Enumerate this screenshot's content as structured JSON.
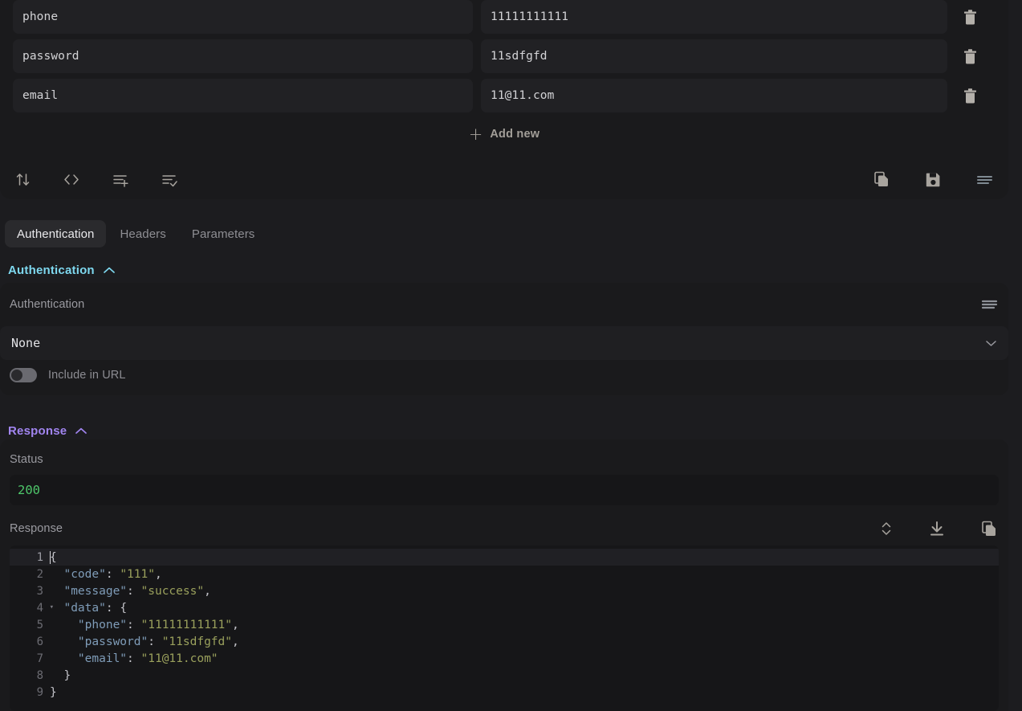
{
  "body_editor": {
    "rows": [
      {
        "key": "phone",
        "value": "11111111111",
        "delete_icon": "trash-icon"
      },
      {
        "key": "password",
        "value": "11sdfgfd",
        "delete_icon": "trash-icon"
      },
      {
        "key": "email",
        "value": "11@11.com",
        "delete_icon": "trash-icon"
      }
    ],
    "add_new": {
      "plus": "+",
      "label": "Add new"
    },
    "toolbar_left": [
      "sort-icon",
      "code-brackets-icon",
      "list-add-icon",
      "list-check-icon"
    ],
    "toolbar_right": [
      "copy-icon",
      "save-icon",
      "format-lines-icon"
    ]
  },
  "tabs": [
    {
      "label": "Authentication",
      "active": true
    },
    {
      "label": "Headers",
      "active": false
    },
    {
      "label": "Parameters",
      "active": false
    }
  ],
  "authentication_section": {
    "title": "Authentication",
    "collapse_icon": "chevron-up-icon",
    "field_label": "Authentication",
    "menu_icon": "format-lines-icon",
    "select_value": "None",
    "select_options": [
      "None"
    ],
    "select_chevron": "chevron-down-icon",
    "toggle": {
      "label": "Include in URL",
      "on": false
    }
  },
  "response_section": {
    "title": "Response",
    "collapse_icon": "chevron-up-icon",
    "status_label": "Status",
    "status_value": "200",
    "response_label": "Response",
    "actions": [
      "expand-collapse-icon",
      "download-icon",
      "copy-icon"
    ],
    "code": {
      "language": "json",
      "active_line": 1,
      "fold_lines": [
        1,
        4
      ],
      "lines": [
        {
          "n": "1",
          "tokens": [
            {
              "t": "punc",
              "v": "{"
            }
          ]
        },
        {
          "n": "2",
          "tokens": [
            {
              "t": "plain",
              "v": "  "
            },
            {
              "t": "key",
              "v": "\"code\""
            },
            {
              "t": "punc",
              "v": ": "
            },
            {
              "t": "str",
              "v": "\"111\""
            },
            {
              "t": "punc",
              "v": ","
            }
          ]
        },
        {
          "n": "3",
          "tokens": [
            {
              "t": "plain",
              "v": "  "
            },
            {
              "t": "key",
              "v": "\"message\""
            },
            {
              "t": "punc",
              "v": ": "
            },
            {
              "t": "str",
              "v": "\"success\""
            },
            {
              "t": "punc",
              "v": ","
            }
          ]
        },
        {
          "n": "4",
          "tokens": [
            {
              "t": "plain",
              "v": "  "
            },
            {
              "t": "key",
              "v": "\"data\""
            },
            {
              "t": "punc",
              "v": ": {"
            }
          ]
        },
        {
          "n": "5",
          "tokens": [
            {
              "t": "plain",
              "v": "    "
            },
            {
              "t": "key",
              "v": "\"phone\""
            },
            {
              "t": "punc",
              "v": ": "
            },
            {
              "t": "str",
              "v": "\"11111111111\""
            },
            {
              "t": "punc",
              "v": ","
            }
          ]
        },
        {
          "n": "6",
          "tokens": [
            {
              "t": "plain",
              "v": "    "
            },
            {
              "t": "key",
              "v": "\"password\""
            },
            {
              "t": "punc",
              "v": ": "
            },
            {
              "t": "str",
              "v": "\"11sdfgfd\""
            },
            {
              "t": "punc",
              "v": ","
            }
          ]
        },
        {
          "n": "7",
          "tokens": [
            {
              "t": "plain",
              "v": "    "
            },
            {
              "t": "key",
              "v": "\"email\""
            },
            {
              "t": "punc",
              "v": ": "
            },
            {
              "t": "str",
              "v": "\"11@11.com\""
            }
          ]
        },
        {
          "n": "8",
          "tokens": [
            {
              "t": "plain",
              "v": "  "
            },
            {
              "t": "punc",
              "v": "}"
            }
          ]
        },
        {
          "n": "9",
          "tokens": [
            {
              "t": "punc",
              "v": "}"
            }
          ]
        }
      ]
    }
  },
  "colors": {
    "page_bg": "#1c1c1f",
    "panel_bg": "#1a1a1c",
    "field_bg": "#212124",
    "code_bg": "#161618",
    "auth_accent": "#7ed8ef",
    "response_accent": "#a185f0",
    "status_ok": "#4ec76a",
    "json_key": "#7f9cb8",
    "json_string": "#9aa05c",
    "icon": "#a8a49e"
  }
}
